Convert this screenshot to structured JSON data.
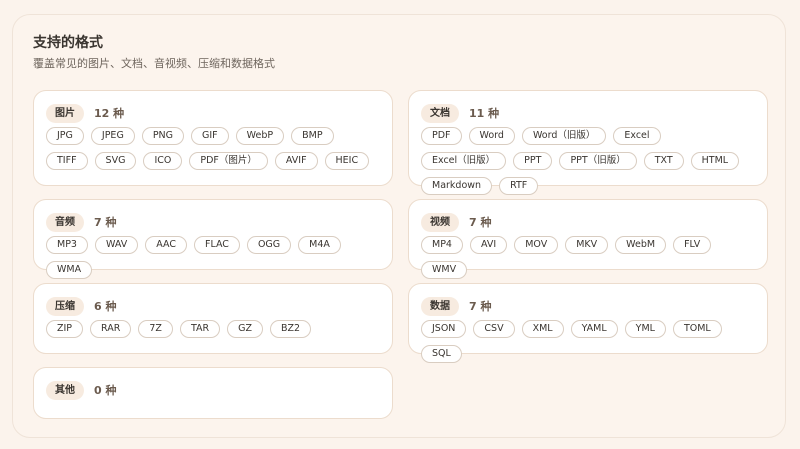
{
  "header": {
    "title": "支持的格式",
    "subtitle": "覆盖常见的图片、文档、音视频、压缩和数据格式"
  },
  "categories": {
    "image": {
      "label": "图片",
      "count": "12 种",
      "formats": [
        "JPG",
        "JPEG",
        "PNG",
        "GIF",
        "WebP",
        "BMP",
        "TIFF",
        "SVG",
        "ICO",
        "PDF（图片）",
        "AVIF",
        "HEIC"
      ]
    },
    "document": {
      "label": "文档",
      "count": "11 种",
      "formats": [
        "PDF",
        "Word",
        "Word（旧版）",
        "Excel",
        "Excel（旧版）",
        "PPT",
        "PPT（旧版）",
        "TXT",
        "HTML",
        "Markdown",
        "RTF"
      ]
    },
    "audio": {
      "label": "音频",
      "count": "7 种",
      "formats": [
        "MP3",
        "WAV",
        "AAC",
        "FLAC",
        "OGG",
        "M4A",
        "WMA"
      ]
    },
    "video": {
      "label": "视频",
      "count": "7 种",
      "formats": [
        "MP4",
        "AVI",
        "MOV",
        "MKV",
        "WebM",
        "FLV",
        "WMV"
      ]
    },
    "archive": {
      "label": "压缩",
      "count": "6 种",
      "formats": [
        "ZIP",
        "RAR",
        "7Z",
        "TAR",
        "GZ",
        "BZ2"
      ]
    },
    "data": {
      "label": "数据",
      "count": "7 种",
      "formats": [
        "JSON",
        "CSV",
        "XML",
        "YAML",
        "YML",
        "TOML",
        "SQL"
      ]
    },
    "other": {
      "label": "其他",
      "count": "0 种",
      "formats": []
    }
  }
}
